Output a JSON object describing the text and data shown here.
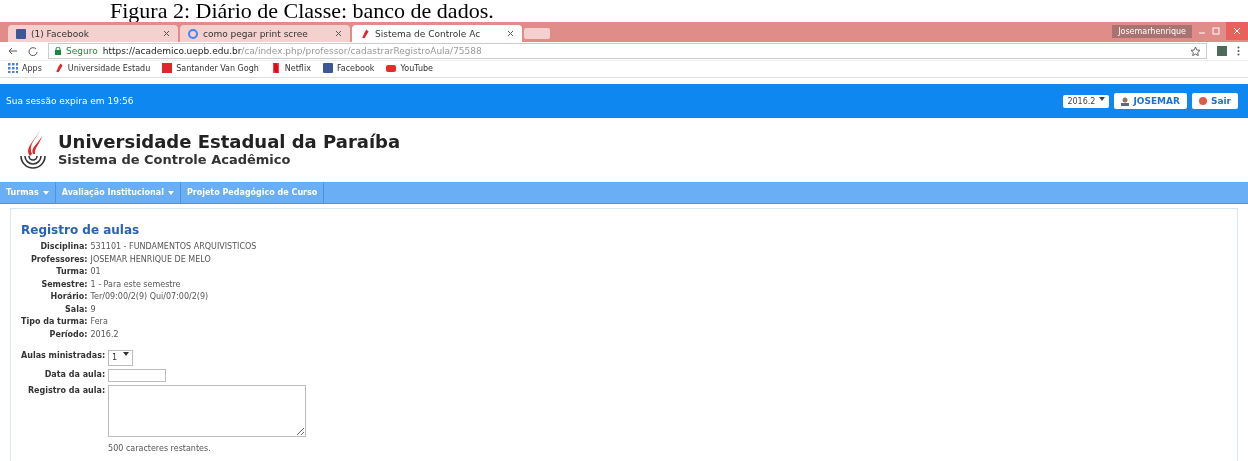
{
  "caption": "Figura 2: Diário de Classe: banco de dados.",
  "browser": {
    "profile": "Josemarhenrique",
    "tabs": [
      {
        "label": "(1) Facebook",
        "selected": false
      },
      {
        "label": "como pegar print scree",
        "selected": false
      },
      {
        "label": "Sistema de Controle Ac",
        "selected": true
      }
    ],
    "secure_label": "Seguro",
    "url_host": "https://academico.uepb.edu.br",
    "url_path": "/ca/index.php/professor/cadastrarRegistroAula/75588",
    "bookmarks": [
      "Apps",
      "Universidade Estadu",
      "Santander Van Gogh",
      "Netflix",
      "Facebook",
      "YouTube"
    ]
  },
  "session_bar": {
    "text": "Sua sessão expira em 19:56",
    "period": "2016.2",
    "user": "JOSEMAR",
    "logout": "Sair"
  },
  "header": {
    "title": "Universidade Estadual da Paraíba",
    "subtitle": "Sistema de Controle Acadêmico"
  },
  "menu": [
    {
      "label": "Turmas",
      "dropdown": true
    },
    {
      "label": "Avaliação Institucional",
      "dropdown": true
    },
    {
      "label": "Projeto Pedagógico de Curso",
      "dropdown": false
    }
  ],
  "content": {
    "title": "Registro de aulas",
    "details": [
      {
        "label": "Disciplina:",
        "value": "531101 - FUNDAMENTOS ARQUIVISTICOS"
      },
      {
        "label": "Professores:",
        "value": "JOSEMAR HENRIQUE DE MELO"
      },
      {
        "label": "Turma:",
        "value": "01"
      },
      {
        "label": "Semestre:",
        "value": "1 - Para este semestre"
      },
      {
        "label": "Horário:",
        "value": "Ter/09:00/2(9) Qui/07:00/2(9)"
      },
      {
        "label": "Sala:",
        "value": "9"
      },
      {
        "label": "Tipo da turma:",
        "value": "Fera"
      },
      {
        "label": "Período:",
        "value": "2016.2"
      }
    ],
    "form": [
      {
        "kind": "select",
        "label": "Aulas ministradas:",
        "value": "1"
      },
      {
        "kind": "input",
        "label": "Data da aula:"
      },
      {
        "kind": "textarea",
        "label": "Registro da aula:",
        "hint": "500 caracteres restantes."
      }
    ]
  }
}
